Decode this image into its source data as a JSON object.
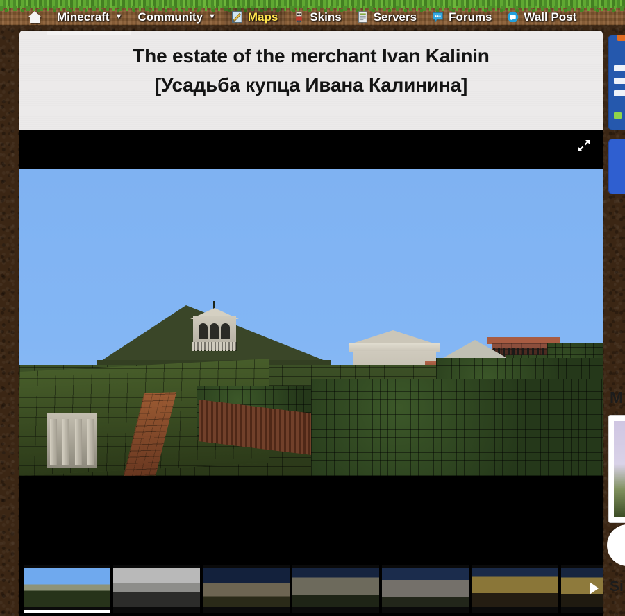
{
  "site": {
    "theme_accent": "#ffe34d",
    "navbar_bg": "#8a5d33",
    "grass_color": "#4d8f2a"
  },
  "navbar": {
    "items": [
      {
        "label": "",
        "icon": "home-icon",
        "active": false,
        "caret": false,
        "name": "home"
      },
      {
        "label": "Minecraft",
        "icon": "",
        "active": false,
        "caret": true,
        "name": "minecraft"
      },
      {
        "label": "Community",
        "icon": "",
        "active": false,
        "caret": true,
        "name": "community"
      },
      {
        "label": "Maps",
        "icon": "map-pencil-icon",
        "active": true,
        "caret": false,
        "name": "maps"
      },
      {
        "label": "Skins",
        "icon": "skin-icon",
        "active": false,
        "caret": false,
        "name": "skins"
      },
      {
        "label": "Servers",
        "icon": "server-icon",
        "active": false,
        "caret": false,
        "name": "servers"
      },
      {
        "label": "Forums",
        "icon": "speech-bubble-icon",
        "active": false,
        "caret": false,
        "name": "forums"
      },
      {
        "label": "Wall Post",
        "icon": "wall-post-icon",
        "active": false,
        "caret": false,
        "name": "wall-post"
      }
    ]
  },
  "page": {
    "title_line_1": "The estate of the merchant Ivan Kalinin",
    "title_line_2": "[Усадьба купца Ивана Калинина]"
  },
  "viewer": {
    "fullscreen_icon": "expand-arrows-icon",
    "next_icon": "play-arrow-icon",
    "active_thumb_index": 0,
    "thumbnails": [
      {
        "name": "thumb-1-estate-daylight"
      },
      {
        "name": "thumb-2-estate-grey"
      },
      {
        "name": "thumb-3-manor-dusk"
      },
      {
        "name": "thumb-4-chapel"
      },
      {
        "name": "thumb-5-church-street"
      },
      {
        "name": "thumb-6-yellow-gate"
      },
      {
        "name": "thumb-7-yellow-wall"
      }
    ]
  },
  "sidebar": {
    "heading_1": "M",
    "heading_2": "Si"
  }
}
